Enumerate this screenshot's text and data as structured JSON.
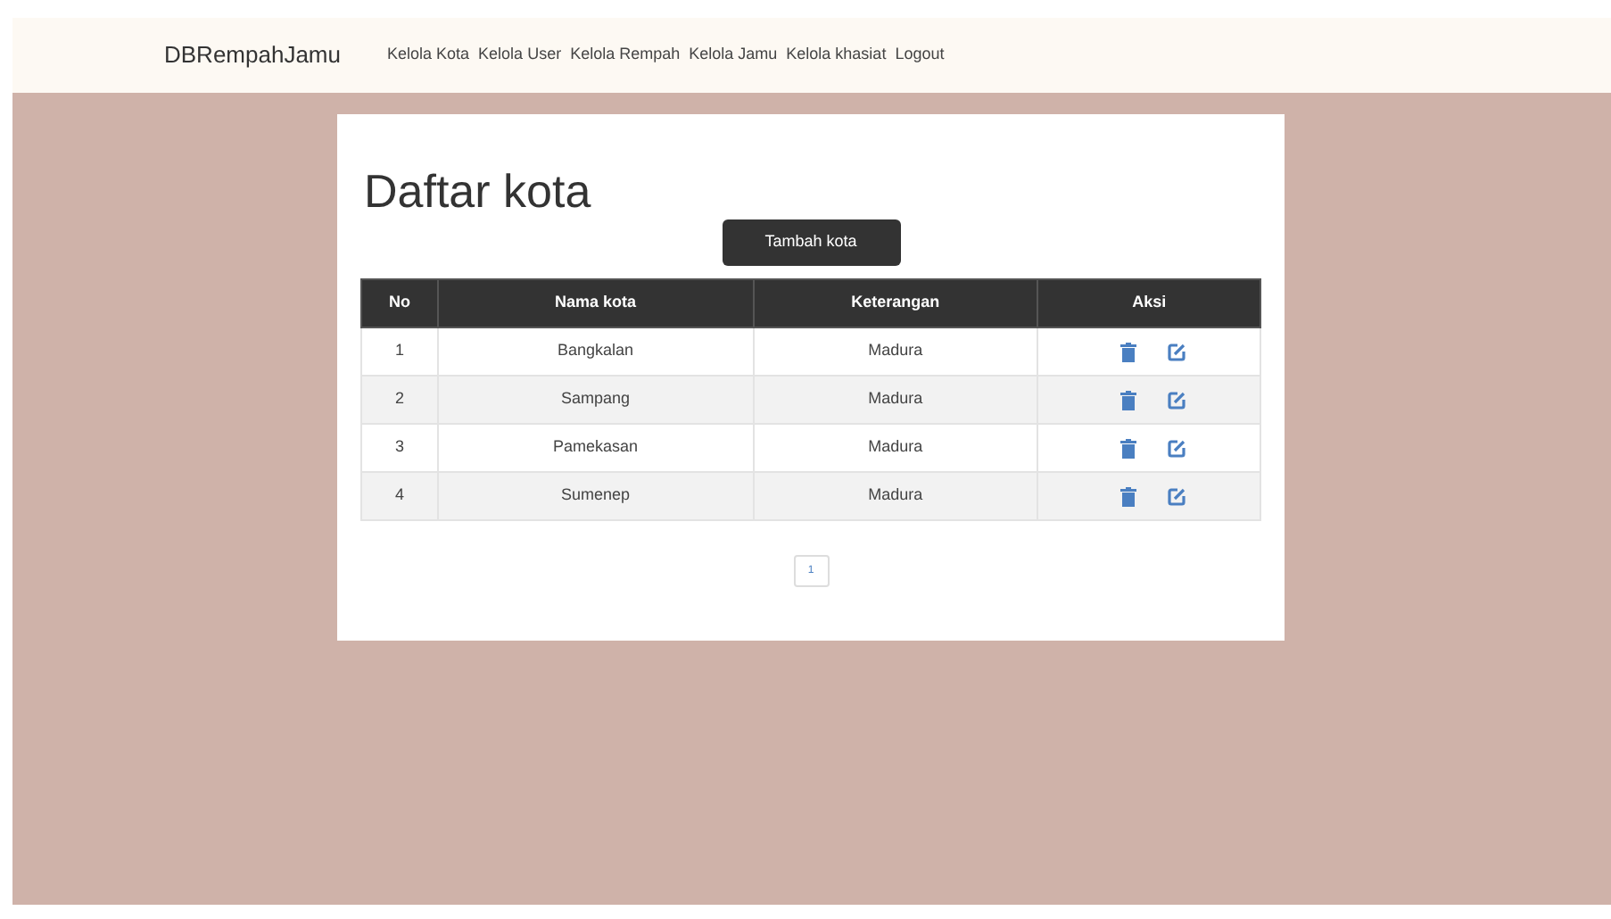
{
  "navbar": {
    "brand": "DBRempahJamu",
    "links": [
      "Kelola Kota",
      "Kelola User",
      "Kelola Rempah",
      "Kelola Jamu",
      "Kelola khasiat",
      "Logout"
    ]
  },
  "page": {
    "title": "Daftar kota",
    "add_button": "Tambah kota"
  },
  "table": {
    "columns": [
      "No",
      "Nama kota",
      "Keterangan",
      "Aksi"
    ],
    "rows": [
      {
        "no": "1",
        "nama": "Bangkalan",
        "keterangan": "Madura"
      },
      {
        "no": "2",
        "nama": "Sampang",
        "keterangan": "Madura"
      },
      {
        "no": "3",
        "nama": "Pamekasan",
        "keterangan": "Madura"
      },
      {
        "no": "4",
        "nama": "Sumenep",
        "keterangan": "Madura"
      }
    ]
  },
  "pagination": {
    "pages": [
      {
        "label": "1",
        "selected": true
      }
    ]
  }
}
